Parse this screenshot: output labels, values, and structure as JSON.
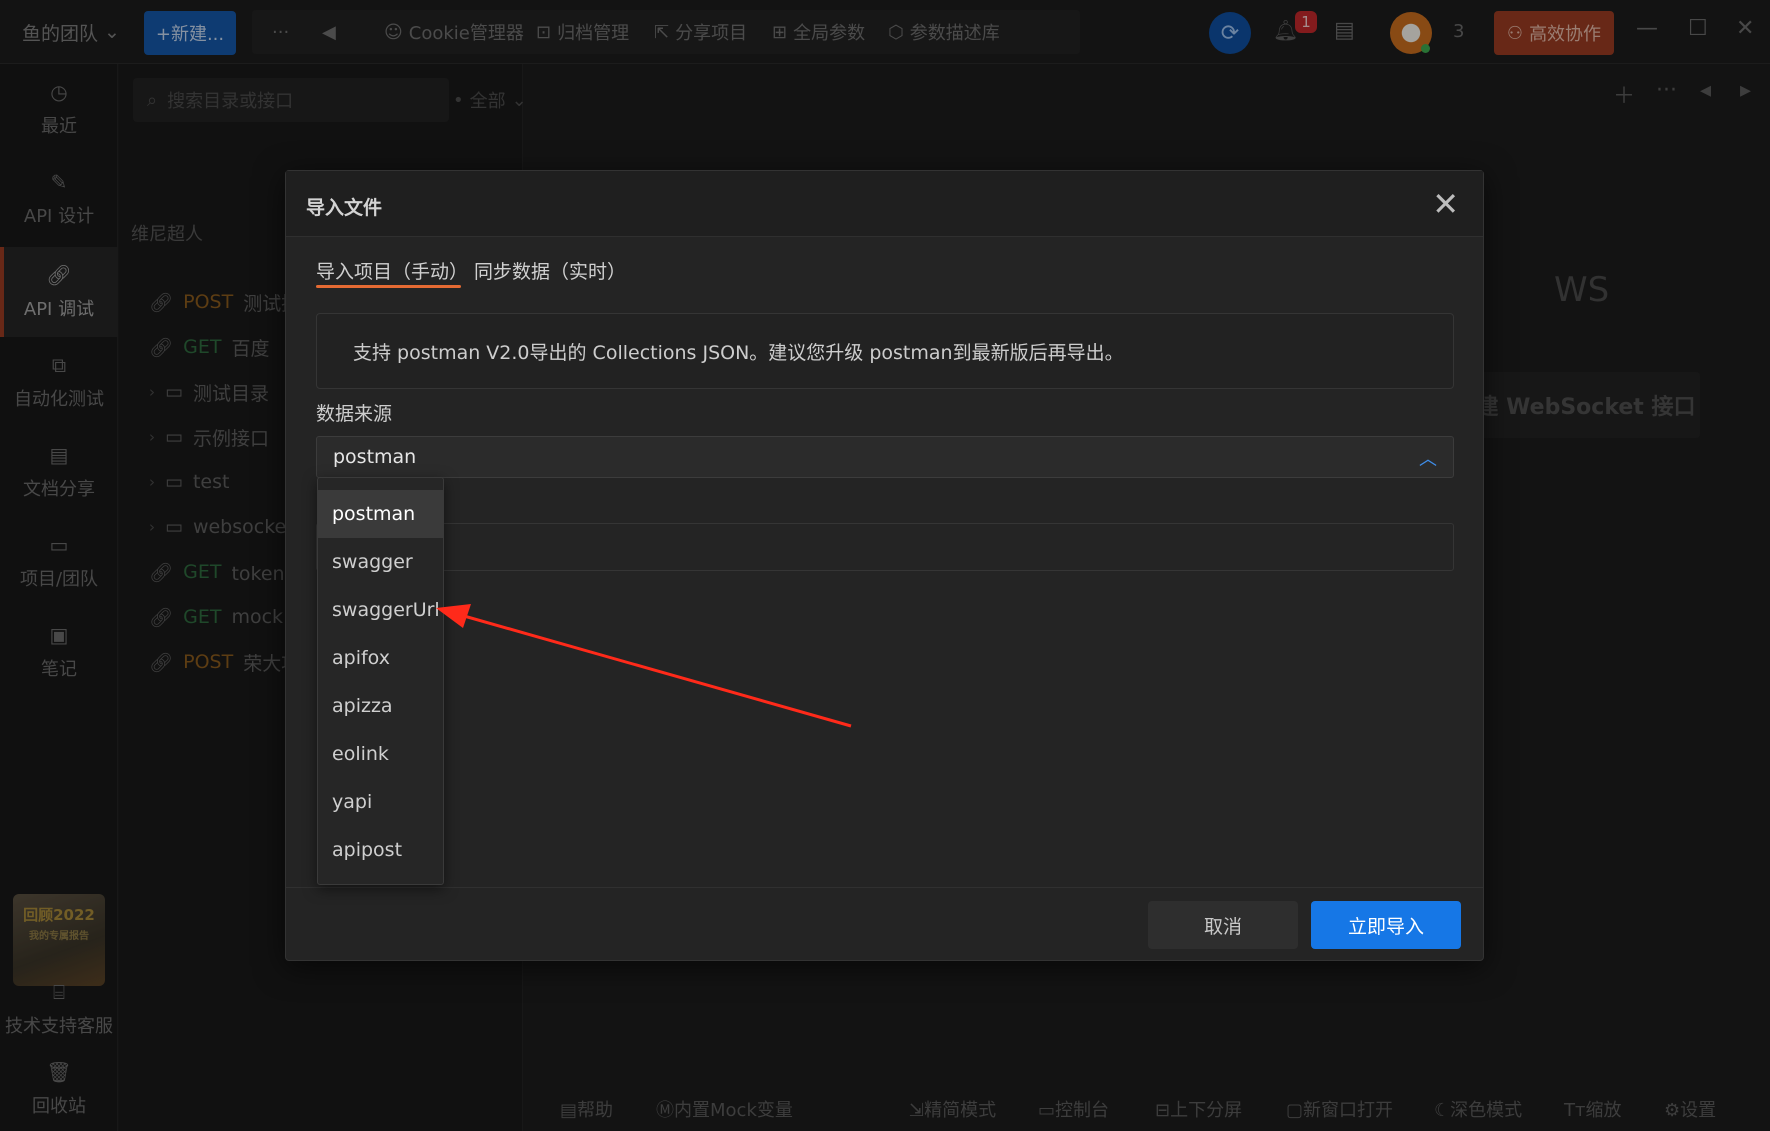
{
  "topbar": {
    "team": "鱼的团队",
    "new_button": "+新建...",
    "more": "···",
    "back": "◀",
    "tools": [
      "Cookie管理器",
      "归档管理",
      "分享项目",
      "全局参数",
      "参数描述库"
    ],
    "bell_badge": "1",
    "member_count": "3",
    "collab_button": "高效协作"
  },
  "leftnav": {
    "items": [
      "最近",
      "API 设计",
      "API 调试",
      "自动化测试",
      "文档分享",
      "项目/团队",
      "笔记"
    ],
    "active": "API 调试",
    "promo_line1": "回顾2022",
    "promo_line2": "我的专属报告",
    "support": "技术支持客服",
    "trash": "回收站"
  },
  "tree": {
    "search_placeholder": "搜索目录或接口",
    "filter": "全部",
    "team_label": "维尼超人",
    "rows": [
      {
        "method": "POST",
        "name": "测试接口"
      },
      {
        "method": "GET",
        "name": "百度"
      },
      {
        "folder": "测试目录"
      },
      {
        "folder": "示例接口"
      },
      {
        "folder": "test"
      },
      {
        "folder": "websocket"
      },
      {
        "method": "GET",
        "name": "token接口"
      },
      {
        "method": "GET",
        "name": "mock"
      },
      {
        "method": "POST",
        "name": "荣大项目"
      }
    ]
  },
  "right": {
    "ws_label": "WS",
    "ws_button": "新建 WebSocket 接口"
  },
  "bottombar": [
    "帮助",
    "内置Mock变量",
    "精简模式",
    "控制台",
    "上下分屏",
    "新窗口打开",
    "深色模式",
    "缩放",
    "设置"
  ],
  "modal": {
    "title": "导入文件",
    "tabs": [
      "导入项目（手动）",
      "同步数据（实时）"
    ],
    "info": "支持 postman V2.0导出的 Collections JSON。建议您升级 postman到最新版后再导出。",
    "source_label": "数据来源",
    "selected_source": "postman",
    "options": [
      "postman",
      "swagger",
      "swaggerUrl",
      "apifox",
      "apizza",
      "eolink",
      "yapi",
      "apipost"
    ],
    "cancel": "取消",
    "confirm": "立即导入"
  },
  "colors": {
    "accent_blue": "#1677e6",
    "tab_underline": "#e56a33",
    "annotation_arrow": "#ff2a1a"
  }
}
